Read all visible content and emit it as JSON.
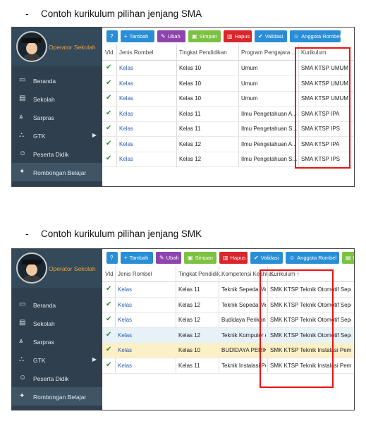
{
  "sections": [
    {
      "heading": "Contoh kurikulum pilihan jenjang SMA",
      "role": "Operator Sekolah",
      "nav": [
        {
          "icon": "monitor-icon",
          "glyph": "▭",
          "label": "Beranda"
        },
        {
          "icon": "building-icon",
          "glyph": "▤",
          "label": "Sekolah"
        },
        {
          "icon": "road-icon",
          "glyph": "⩓",
          "label": "Sarpras"
        },
        {
          "icon": "graduation-cap-icon",
          "glyph": "⛬",
          "label": "GTK",
          "arrow": "▶"
        },
        {
          "icon": "smile-icon",
          "glyph": "☺",
          "label": "Peserta Didik"
        },
        {
          "icon": "users-icon",
          "glyph": "✦",
          "label": "Rombongan Belajar",
          "active": true
        }
      ],
      "toolbar": [
        {
          "icon": "help-icon",
          "glyph": "?",
          "label": "",
          "color": "#2a8ed6"
        },
        {
          "icon": "plus-icon",
          "glyph": "+",
          "label": "Tambah",
          "color": "#2a8ed6"
        },
        {
          "icon": "pencil-icon",
          "glyph": "✎",
          "label": "Ubah",
          "color": "#8e44ad"
        },
        {
          "icon": "save-icon",
          "glyph": "▣",
          "label": "Simpan",
          "color": "#7cc242"
        },
        {
          "icon": "trash-icon",
          "glyph": "▥",
          "label": "Hapus",
          "color": "#d9262b"
        },
        {
          "icon": "check-icon",
          "glyph": "✔",
          "label": "Validasi",
          "color": "#2a8ed6"
        },
        {
          "icon": "member-icon",
          "glyph": "☺",
          "label": "Anggota Rombel",
          "color": "#2a8ed6"
        }
      ],
      "columns": [
        "Vld",
        "Jenis Rombel",
        "Tingkat Pendidikan",
        "Program Pengajara...",
        "Kurikulum"
      ],
      "rows": [
        [
          "✔",
          "Kelas",
          "Kelas 10",
          "Umum",
          "SMA KTSP UMUM"
        ],
        [
          "✔",
          "Kelas",
          "Kelas 10",
          "Umum",
          "SMA KTSP UMUM"
        ],
        [
          "✔",
          "Kelas",
          "Kelas 10",
          "Umum",
          "SMA KTSP UMUM"
        ],
        [
          "✔",
          "Kelas",
          "Kelas 11",
          "Ilmu Pengetahuan A...",
          "SMA KTSP IPA"
        ],
        [
          "✔",
          "Kelas",
          "Kelas 11",
          "Ilmu Pengetahuan S...",
          "SMA KTSP IPS"
        ],
        [
          "✔",
          "Kelas",
          "Kelas 12",
          "Ilmu Pengetahuan A...",
          "SMA KTSP IPA"
        ],
        [
          "✔",
          "Kelas",
          "Kelas 12",
          "Ilmu Pengetahuan S...",
          "SMA KTSP IPS"
        ]
      ]
    },
    {
      "heading": "Contoh kurikulum pilihan jenjang SMK",
      "role": "Operator Sekolah",
      "nav": [
        {
          "icon": "monitor-icon",
          "glyph": "▭",
          "label": "Beranda"
        },
        {
          "icon": "building-icon",
          "glyph": "▤",
          "label": "Sekolah"
        },
        {
          "icon": "road-icon",
          "glyph": "⩓",
          "label": "Sarpras"
        },
        {
          "icon": "graduation-cap-icon",
          "glyph": "⛬",
          "label": "GTK",
          "arrow": "▶"
        },
        {
          "icon": "smile-icon",
          "glyph": "☺",
          "label": "Peserta Didik"
        },
        {
          "icon": "users-icon",
          "glyph": "✦",
          "label": "Rombongan Belajar",
          "active": true
        }
      ],
      "toolbar": [
        {
          "icon": "help-icon",
          "glyph": "?",
          "label": "",
          "color": "#2a8ed6"
        },
        {
          "icon": "plus-icon",
          "glyph": "+",
          "label": "Tambah",
          "color": "#2a8ed6"
        },
        {
          "icon": "pencil-icon",
          "glyph": "✎",
          "label": "Ubah",
          "color": "#8e44ad"
        },
        {
          "icon": "save-icon",
          "glyph": "▣",
          "label": "Simpan",
          "color": "#7cc242"
        },
        {
          "icon": "trash-icon",
          "glyph": "▥",
          "label": "Hapus",
          "color": "#d9262b"
        },
        {
          "icon": "check-icon",
          "glyph": "✔",
          "label": "Validasi",
          "color": "#2a8ed6"
        },
        {
          "icon": "member-icon",
          "glyph": "☺",
          "label": "Anggota Rombel",
          "color": "#2a8ed6"
        },
        {
          "icon": "document-icon",
          "glyph": "▤",
          "label": "Pembe",
          "color": "#7cc242"
        }
      ],
      "columns": [
        "Vld",
        "Jenis Rombel",
        "Tingkat Pendidik..",
        "Kompetensi Keahlia...",
        "Kurikulum  ↑"
      ],
      "rows": [
        [
          "✔",
          "Kelas",
          "Kelas 11",
          "Teknik Sepeda Motor",
          "SMK KTSP Teknik Otomotif Sepeda ..."
        ],
        [
          "✔",
          "Kelas",
          "Kelas 12",
          "Teknik Sepeda Motor",
          "SMK KTSP Teknik Otomotif Sepeda ..."
        ],
        [
          "✔",
          "Kelas",
          "Kelas 12",
          "Budidaya Perikanan",
          "SMK KTSP Teknik Otomotif Sepeda ..."
        ],
        [
          "✔",
          "Kelas",
          "Kelas 12",
          "Teknik Komputer da...",
          "SMK KTSP Teknik Otomotif Sepeda ..."
        ],
        [
          "✔",
          "Kelas",
          "Kelas 10",
          "BUDIDAYA PERIKAN...",
          "SMK KTSP Teknik Instalasi Pemesina..."
        ],
        [
          "✔",
          "Kelas",
          "Kelas 11",
          "Teknik Instalasi Pem...",
          "SMK KTSP Teknik Instalasi Pemesina..."
        ]
      ]
    }
  ]
}
